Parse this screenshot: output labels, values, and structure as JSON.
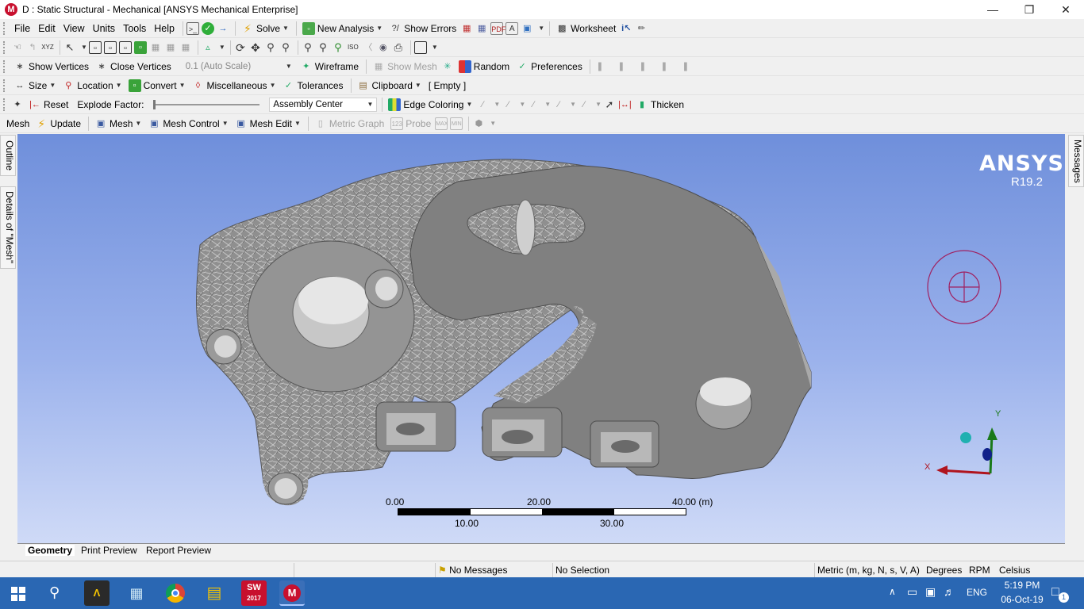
{
  "window": {
    "title": "D : Static Structural - Mechanical [ANSYS Mechanical Enterprise]",
    "app_icon_letter": "M"
  },
  "menu": {
    "items": [
      "File",
      "Edit",
      "View",
      "Units",
      "Tools",
      "Help"
    ],
    "solve": "Solve",
    "new_analysis": "New Analysis",
    "show_errors": "Show Errors",
    "worksheet": "Worksheet"
  },
  "vertex_bar": {
    "show_vertices": "Show Vertices",
    "close_vertices": "Close Vertices",
    "scale_combo": "0.1 (Auto Scale)",
    "wireframe": "Wireframe",
    "show_mesh": "Show Mesh",
    "random": "Random",
    "preferences": "Preferences"
  },
  "context_bar": {
    "size": "Size",
    "location": "Location",
    "convert": "Convert",
    "miscellaneous": "Miscellaneous",
    "tolerances": "Tolerances",
    "clipboard": "Clipboard",
    "clipboard_state": "[ Empty ]"
  },
  "explode_bar": {
    "reset": "Reset",
    "explode_factor": "Explode Factor:",
    "assembly_center": "Assembly Center",
    "edge_coloring": "Edge Coloring",
    "thicken": "Thicken"
  },
  "mesh_bar": {
    "mesh_label": "Mesh",
    "update": "Update",
    "mesh": "Mesh",
    "mesh_control": "Mesh Control",
    "mesh_edit": "Mesh Edit",
    "metric_graph": "Metric Graph",
    "probe": "Probe"
  },
  "side_tabs": {
    "outline": "Outline",
    "details": "Details of \"Mesh\"",
    "messages": "Messages"
  },
  "viewport": {
    "brand": "ANSYS",
    "version": "R19.2",
    "scale_top_labels": [
      "0.00",
      "20.00",
      "40.00 (m)"
    ],
    "scale_bottom_labels": [
      "10.00",
      "30.00"
    ],
    "axis_x": "X",
    "axis_y": "Y"
  },
  "bottom_tabs": [
    "Geometry",
    "Print Preview",
    "Report Preview"
  ],
  "status": {
    "messages": "No Messages",
    "selection": "No Selection",
    "units": "Metric (m, kg, N, s, V, A)",
    "angle": "Degrees",
    "speed": "RPM",
    "temperature": "Celsius"
  },
  "taskbar": {
    "lang": "ENG",
    "time": "5:19 PM",
    "date": "06-Oct-19",
    "notification_count": "1",
    "sw_label": "SW",
    "sw_year": "2017"
  }
}
